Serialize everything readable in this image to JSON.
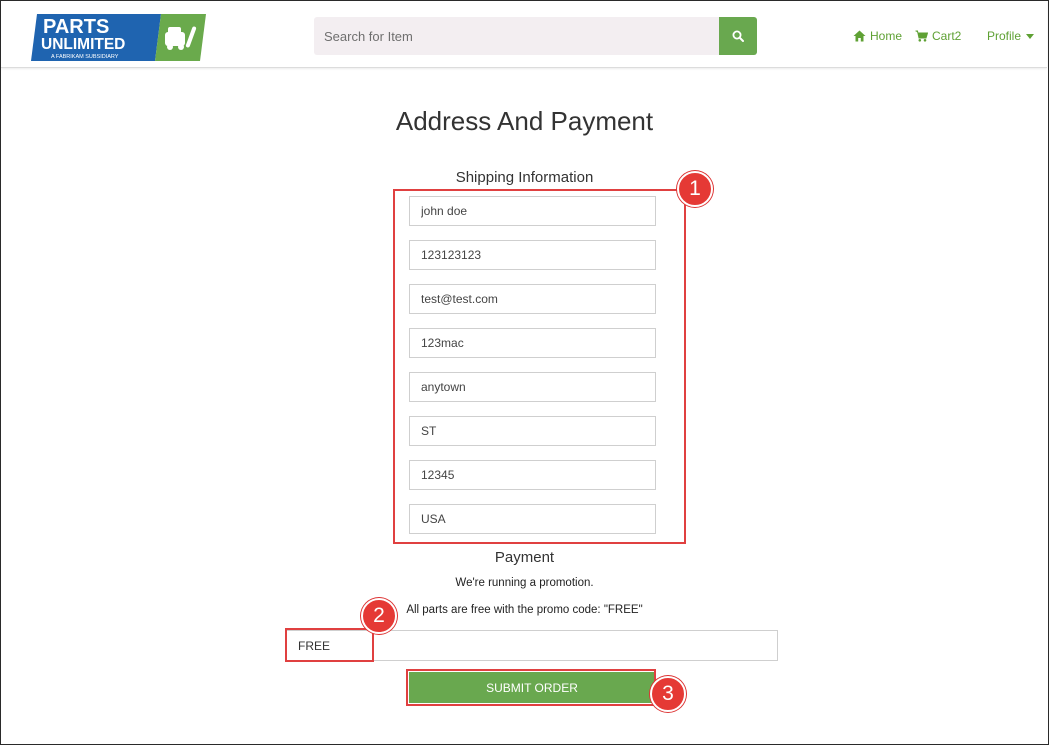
{
  "header": {
    "logo": {
      "line1": "PARTS",
      "line2": "UNLIMITED",
      "tagline": "A FABRIKAM SUBSIDIARY",
      "colors": {
        "blue": "#1f64b0",
        "green": "#6aaa4c"
      }
    },
    "search": {
      "placeholder": "Search for Item",
      "value": ""
    },
    "nav": {
      "home_label": "Home",
      "cart_label": "Cart2",
      "profile_label": "Profile"
    },
    "accent_color": "#5fa134"
  },
  "main": {
    "title": "Address And Payment",
    "shipping": {
      "heading": "Shipping Information",
      "fields": [
        {
          "value": "john doe"
        },
        {
          "value": "123123123"
        },
        {
          "value": "test@test.com"
        },
        {
          "value": "123mac"
        },
        {
          "value": "anytown"
        },
        {
          "value": "ST"
        },
        {
          "value": "12345"
        },
        {
          "value": "USA"
        }
      ]
    },
    "payment": {
      "heading": "Payment",
      "promo_line1": "We're running a promotion.",
      "promo_line2": "All parts are free with the promo code: \"FREE\"",
      "promo_value": "FREE"
    },
    "submit_label": "SUBMIT ORDER"
  },
  "annotations": {
    "badges": [
      "1",
      "2",
      "3"
    ],
    "color": "#e53935"
  }
}
